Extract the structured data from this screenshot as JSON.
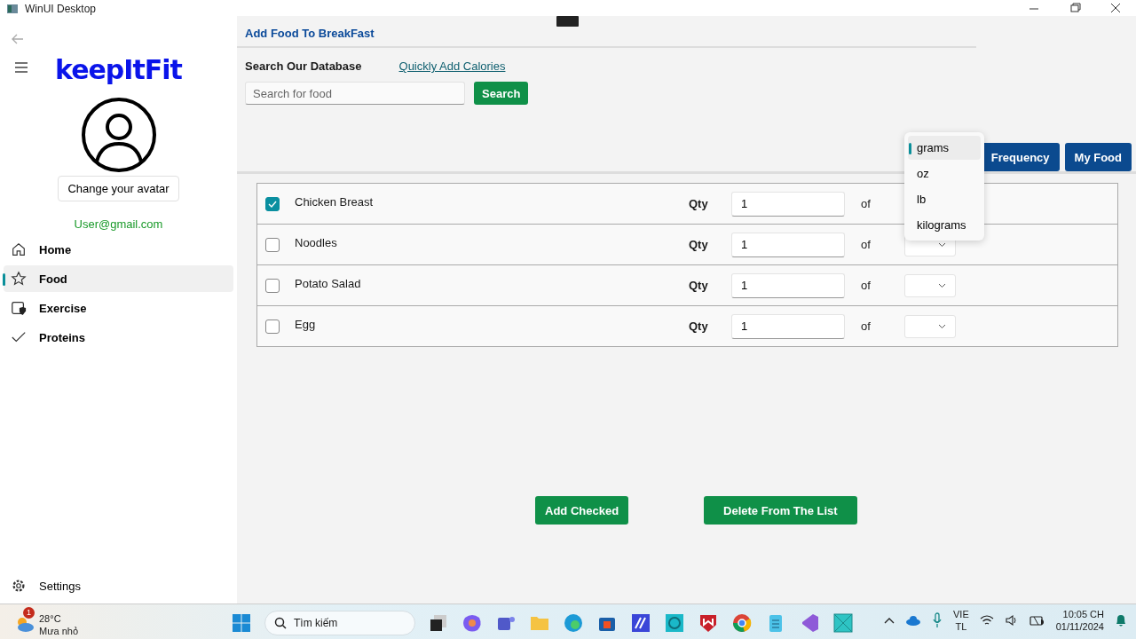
{
  "window": {
    "title": "WinUI Desktop"
  },
  "sidebar": {
    "logo": "keepItFit",
    "avatar_button": "Change your avatar",
    "email": "User@gmail.com",
    "items": [
      {
        "label": "Home",
        "selected": false
      },
      {
        "label": "Food",
        "selected": true
      },
      {
        "label": "Exercise",
        "selected": false
      },
      {
        "label": "Proteins",
        "selected": false
      }
    ],
    "settings": "Settings"
  },
  "page": {
    "title": "Add Food To BreakFast",
    "search_label": "Search Our Database",
    "quick_link": "Quickly Add Calories",
    "search": {
      "placeholder": "Search for food"
    },
    "search_button": "Search",
    "tabs": [
      "Frequency",
      "My Food"
    ],
    "rows": [
      {
        "name": "Chicken Breast",
        "checked": true,
        "qty_label": "Qty",
        "qty": "1",
        "of_label": "of",
        "dropdown_open": true
      },
      {
        "name": "Noodles",
        "checked": false,
        "qty_label": "Qty",
        "qty": "1",
        "of_label": "of",
        "dropdown_open": false
      },
      {
        "name": "Potato Salad",
        "checked": false,
        "qty_label": "Qty",
        "qty": "1",
        "of_label": "of",
        "dropdown_open": false
      },
      {
        "name": "Egg",
        "checked": false,
        "qty_label": "Qty",
        "qty": "1",
        "of_label": "of",
        "dropdown_open": false
      }
    ],
    "units": [
      {
        "label": "grams",
        "selected": true
      },
      {
        "label": "oz",
        "selected": false
      },
      {
        "label": "lb",
        "selected": false
      },
      {
        "label": "kilograms",
        "selected": false
      }
    ],
    "buttons": [
      "Add Checked",
      "Delete From The List"
    ]
  },
  "taskbar": {
    "weather": {
      "temp": "28°C",
      "text": "Mưa nhỏ",
      "badge": "1"
    },
    "search": "Tìm kiếm",
    "lang": [
      "VIE",
      "TL"
    ],
    "time": "10:05 CH",
    "date": "01/11/2024"
  }
}
